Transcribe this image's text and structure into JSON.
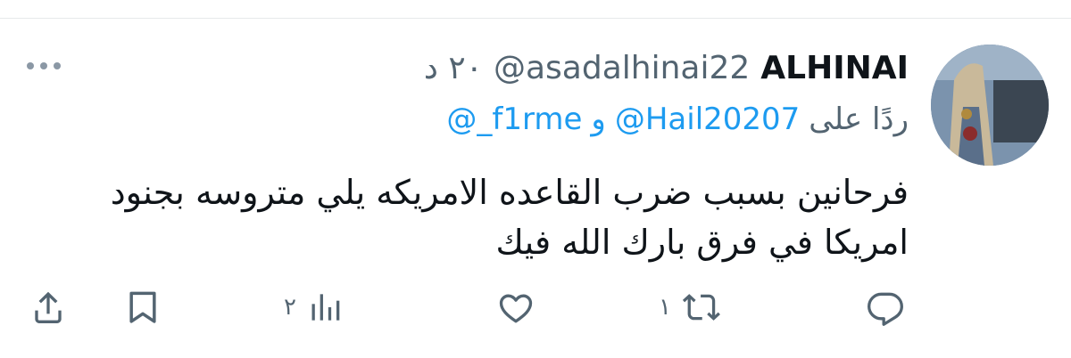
{
  "tweet": {
    "display_name": "ALHINAI",
    "handle": "@asadalhinai22",
    "time": "٢٠ د",
    "replying_to_label": "ردًا على",
    "reply_mentions": [
      "@Hail20207",
      "@_f1rme"
    ],
    "reply_and": "و",
    "body_lines": [
      "فرحانين بسبب ضرب القاعده الامريكه يلي متروسه بجنود",
      "امريكا في فرق بارك الله فيك"
    ]
  },
  "actions": {
    "reply": {
      "icon": "reply-icon",
      "count": ""
    },
    "retweet": {
      "icon": "retweet-icon",
      "count": "١"
    },
    "like": {
      "icon": "like-icon",
      "count": ""
    },
    "views": {
      "icon": "views-icon",
      "count": "٢"
    },
    "bookmark": {
      "icon": "bookmark-icon",
      "count": ""
    },
    "share": {
      "icon": "share-icon",
      "count": ""
    }
  },
  "colors": {
    "accent": "#1d9bf0",
    "secondary": "#536471",
    "text": "#0f1419",
    "divider": "#e7e9ea"
  }
}
